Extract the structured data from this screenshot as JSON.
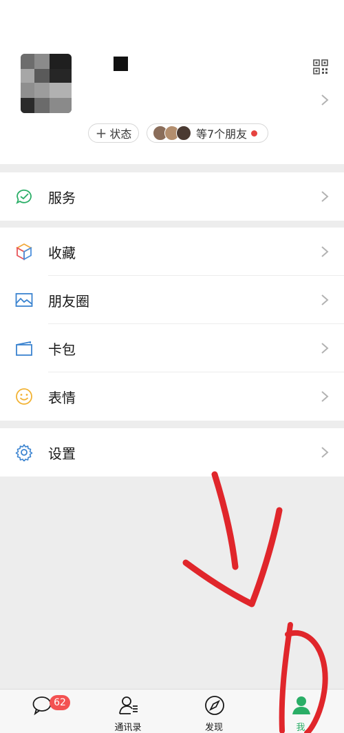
{
  "profile": {
    "status_label": "状态",
    "friends_label": "等7个朋友"
  },
  "menu": {
    "services": "服务",
    "favorites": "收藏",
    "moments": "朋友圈",
    "cards": "卡包",
    "stickers": "表情",
    "settings": "设置"
  },
  "tabbar": {
    "chats_badge": "62",
    "contacts": "通讯录",
    "discover": "发现",
    "me": "我"
  },
  "colors": {
    "accent_green": "#07c160",
    "badge_red": "#f35151",
    "annotation_red": "#e0262b"
  }
}
